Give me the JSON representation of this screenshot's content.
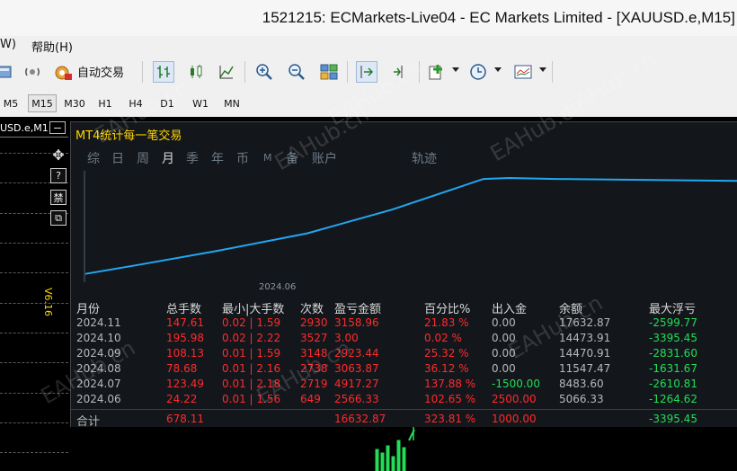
{
  "window": {
    "title": "1521215: ECMarkets-Live04 - EC Markets Limited - [XAUUSD.e,M15]"
  },
  "menu": {
    "items": [
      "W)",
      "帮助(H)"
    ]
  },
  "toolbar": {
    "auto_trading_label": "自动交易"
  },
  "timeframes": [
    {
      "label": "M5",
      "active": false
    },
    {
      "label": "M15",
      "active": true
    },
    {
      "label": "M30",
      "active": false
    },
    {
      "label": "H1",
      "active": false
    },
    {
      "label": "H4",
      "active": false
    },
    {
      "label": "D1",
      "active": false
    },
    {
      "label": "W1",
      "active": false
    },
    {
      "label": "MN",
      "active": false
    }
  ],
  "chart_window": {
    "symbol_label": "USD.e,M1",
    "version_label": "V6.16",
    "side_icons": [
      "?",
      "禁",
      "⧉"
    ]
  },
  "watermark": "EAHub.cn",
  "panel": {
    "title": "MT4统计每一笔交易",
    "tabs": [
      {
        "label": "综",
        "active": false
      },
      {
        "label": "日",
        "active": false
      },
      {
        "label": "周",
        "active": false
      },
      {
        "label": "月",
        "active": true
      },
      {
        "label": "季",
        "active": false
      },
      {
        "label": "年",
        "active": false
      },
      {
        "label": "币",
        "active": false
      },
      {
        "label": "M",
        "active": false
      },
      {
        "label": "备",
        "active": false
      },
      {
        "label": "账户",
        "active": false
      },
      {
        "label": "轨迹",
        "active": false
      }
    ],
    "equity_curve": {
      "x_label": "2024.06",
      "points": [
        [
          0,
          0.03
        ],
        [
          0.08,
          0.12
        ],
        [
          0.2,
          0.26
        ],
        [
          0.34,
          0.44
        ],
        [
          0.47,
          0.68
        ],
        [
          0.61,
          0.99
        ],
        [
          0.65,
          1.0
        ],
        [
          0.72,
          0.99
        ],
        [
          1.0,
          0.97
        ]
      ]
    },
    "table": {
      "headers": [
        "月份",
        "总手数",
        "最小|大手数",
        "次数",
        "盈亏金额",
        "百分比%",
        "出入金",
        "余额",
        "最大浮亏"
      ],
      "rows": [
        {
          "month": "2024.11",
          "lots": "147.61",
          "minmax": "0.02 | 1.59",
          "count": "2930",
          "pnl": "3158.96",
          "pct": "21.83 %",
          "deposit": "0.00",
          "balance": "17632.87",
          "dd": "-2599.77"
        },
        {
          "month": "2024.10",
          "lots": "195.98",
          "minmax": "0.02 | 2.22",
          "count": "3527",
          "pnl": "3.00",
          "pct": "0.02 %",
          "deposit": "0.00",
          "balance": "14473.91",
          "dd": "-3395.45"
        },
        {
          "month": "2024.09",
          "lots": "108.13",
          "minmax": "0.01 | 1.59",
          "count": "3148",
          "pnl": "2923.44",
          "pct": "25.32 %",
          "deposit": "0.00",
          "balance": "14470.91",
          "dd": "-2831.60"
        },
        {
          "month": "2024.08",
          "lots": "78.68",
          "minmax": "0.01 | 2.16",
          "count": "2738",
          "pnl": "3063.87",
          "pct": "36.12 %",
          "deposit": "0.00",
          "balance": "11547.47",
          "dd": "-1631.67"
        },
        {
          "month": "2024.07",
          "lots": "123.49",
          "minmax": "0.01 | 2.18",
          "count": "2719",
          "pnl": "4917.27",
          "pct": "137.88 %",
          "deposit": "-1500.00",
          "balance": "8483.60",
          "dd": "-2610.81"
        },
        {
          "month": "2024.06",
          "lots": "24.22",
          "minmax": "0.01 | 1.56",
          "count": "649",
          "pnl": "2566.33",
          "pct": "102.65 %",
          "deposit": "2500.00",
          "balance": "5066.33",
          "dd": "-1264.62"
        }
      ],
      "total": {
        "label": "合计",
        "lots": "678.11",
        "pnl": "16632.87",
        "pct": "323.81 %",
        "deposit": "1000.00",
        "dd": "-3395.45"
      }
    }
  }
}
